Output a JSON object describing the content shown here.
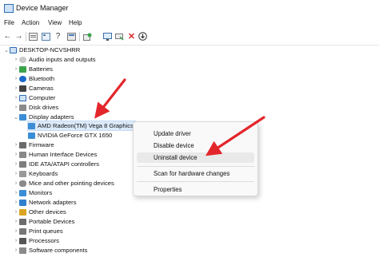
{
  "window": {
    "title": "Device Manager"
  },
  "menu": [
    "File",
    "Action",
    "View",
    "Help"
  ],
  "toolbar_icons": [
    "back-arrow-icon",
    "forward-arrow-icon",
    "properties-icon",
    "view-icon",
    "help-icon",
    "view2-icon",
    "update-driver-icon",
    "scan-icon",
    "enable-icon",
    "uninstall-icon",
    "download-icon"
  ],
  "tree": {
    "root": "DESKTOP-NCVSHRR",
    "items": [
      "Audio inputs and outputs",
      "Batteries",
      "Bluetooth",
      "Cameras",
      "Computer",
      "Disk drives",
      "Display adapters",
      "AMD Radeon(TM) Vega 8 Graphics",
      "NVIDIA GeForce GTX 1650",
      "Firmware",
      "Human Interface Devices",
      "IDE ATA/ATAPI controllers",
      "Keyboards",
      "Mice and other pointing devices",
      "Monitors",
      "Network adapters",
      "Other devices",
      "Portable Devices",
      "Print queues",
      "Processors",
      "Software components"
    ]
  },
  "context_menu": {
    "items": [
      "Update driver",
      "Disable device",
      "Uninstall device",
      "Scan for hardware changes",
      "Properties"
    ]
  },
  "colors": {
    "arrow": "#e3262b",
    "selection": "#dbe9f9"
  }
}
